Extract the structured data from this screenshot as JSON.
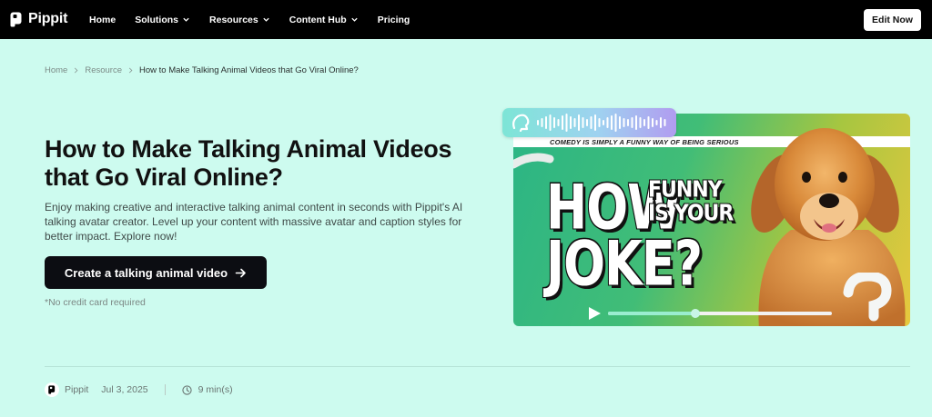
{
  "nav": {
    "brand": "Pippit",
    "links": [
      {
        "label": "Home",
        "has_menu": false
      },
      {
        "label": "Solutions",
        "has_menu": true
      },
      {
        "label": "Resources",
        "has_menu": true
      },
      {
        "label": "Content Hub",
        "has_menu": true
      },
      {
        "label": "Pricing",
        "has_menu": false
      }
    ],
    "cta_label": "Edit Now"
  },
  "breadcrumb": {
    "items": [
      "Home",
      "Resource"
    ],
    "current": "How to Make Talking Animal Videos that Go Viral Online?"
  },
  "hero": {
    "title": "How to Make Talking Animal Videos that Go Viral Online?",
    "description": "Enjoy making creative and interactive talking animal content in seconds with Pippit's AI talking avatar creator. Level up your content with massive avatar and caption styles for better impact. Explore now!",
    "cta_label": "Create a talking animal video",
    "note": "*No credit card required"
  },
  "hero_image": {
    "strip_text": "COMEDY IS SIMPLY A FUNNY WAY OF BEING SERIOUS",
    "words": {
      "how": "HOW",
      "funny": "FUNNY",
      "is_your": "IS YOUR",
      "joke": "JOKE?"
    },
    "progress": 0.39
  },
  "meta": {
    "author": "Pippit",
    "date": "Jul 3, 2025",
    "read_time": "9 min(s)"
  },
  "colors": {
    "background": "#cdfbef",
    "nav_bg": "#000000",
    "cta_bg": "#0c0d12"
  },
  "icons": [
    "pippit-logo-icon",
    "chevron-down-icon",
    "chevron-right-icon",
    "arrow-right-icon",
    "speech-head-icon",
    "play-icon",
    "clock-icon"
  ]
}
